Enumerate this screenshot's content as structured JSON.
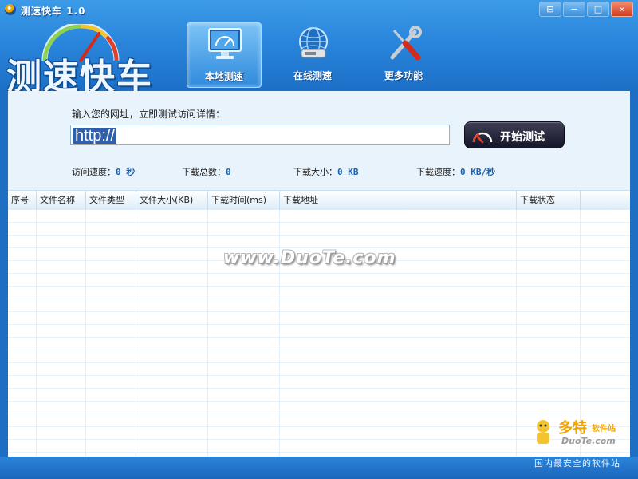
{
  "window": {
    "title": "测速快车 1.0",
    "controls": {
      "menu": "⊟",
      "minimize": "−",
      "maximize": "□",
      "close": "×"
    }
  },
  "logo": {
    "text": "测速快车"
  },
  "nav": {
    "tabs": [
      {
        "label": "本地测速",
        "icon": "monitor-gauge-icon",
        "active": true
      },
      {
        "label": "在线测速",
        "icon": "globe-network-icon",
        "active": false
      },
      {
        "label": "更多功能",
        "icon": "tools-icon",
        "active": false
      }
    ]
  },
  "form": {
    "url_label": "输入您的网址，立即测试访问详情：",
    "url_value": "http://",
    "start_button": "开始测试"
  },
  "stats": {
    "visit_speed": {
      "label": "访问速度：",
      "value": "0 秒"
    },
    "download_total": {
      "label": "下载总数：",
      "value": "0"
    },
    "download_size": {
      "label": "下载大小：",
      "value": "0 KB"
    },
    "download_speed": {
      "label": "下载速度：",
      "value": "0 KB/秒"
    }
  },
  "table": {
    "columns": [
      "序号",
      "文件名称",
      "文件类型",
      "文件大小(KB)",
      "下载时间(ms)",
      "下载地址",
      "下载状态"
    ],
    "rows": []
  },
  "watermark": "www.DuoTe.com",
  "corner_brand": {
    "name": "多特",
    "sub": "软件站",
    "url": "DuoTe.com"
  },
  "status": {
    "text": "国内最安全的软件站"
  },
  "colors": {
    "header": "#2a86dc",
    "panel": "#e8f3fb",
    "accent": "#1860b0",
    "button": "#16162a"
  }
}
